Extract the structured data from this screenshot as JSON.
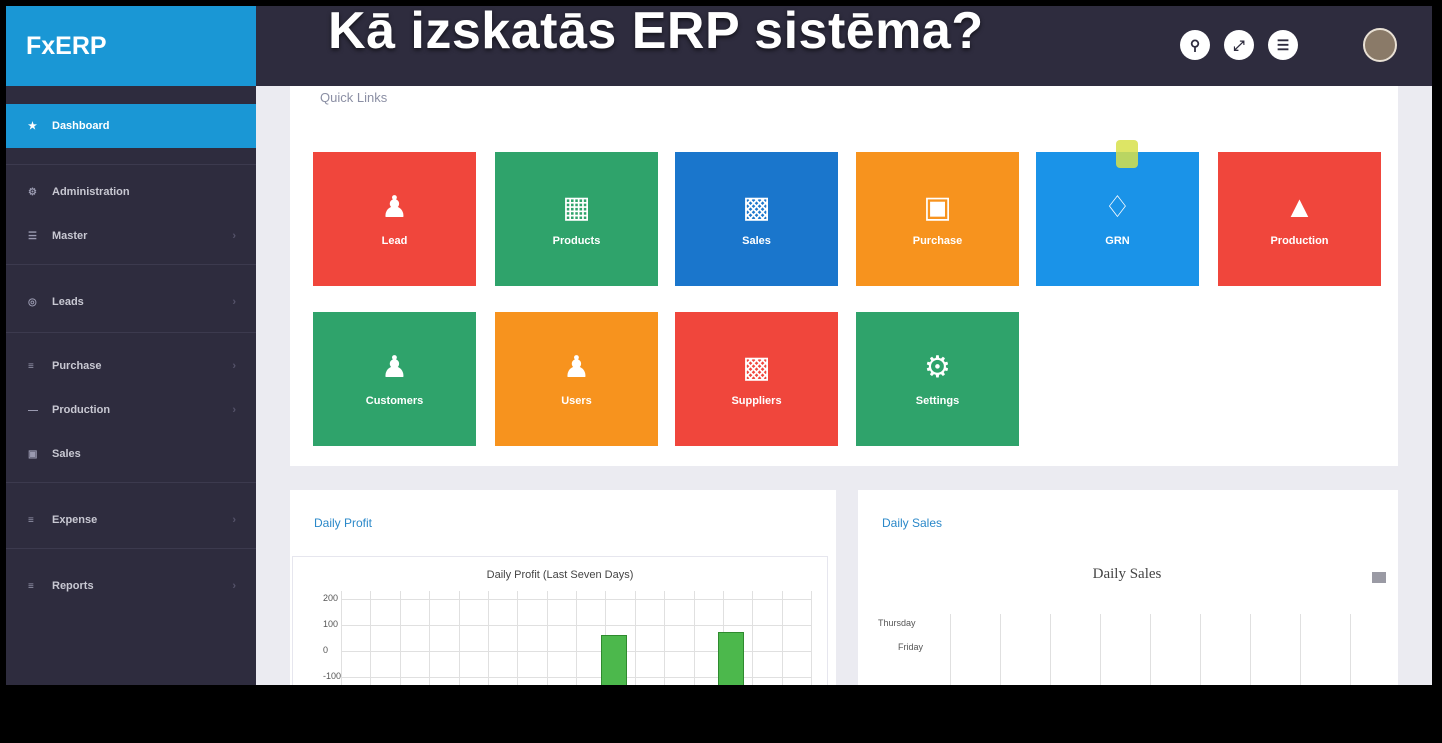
{
  "video_title": "Kā izskatās ERP sistēma?",
  "brand": "FxERP",
  "topbar_icons": [
    "search-icon",
    "expand-icon",
    "menu-icon"
  ],
  "sidebar": {
    "items": [
      {
        "label": "Dashboard",
        "icon": "home-icon",
        "active": true
      },
      {
        "label": "Administration",
        "icon": "gear-icon"
      },
      {
        "label": "Master",
        "icon": "list-icon"
      },
      {
        "label": "Leads",
        "icon": "target-icon"
      },
      {
        "label": "Purchase",
        "icon": "cart-icon"
      },
      {
        "label": "Production",
        "icon": "factory-icon"
      },
      {
        "label": "Sales",
        "icon": "tag-icon"
      },
      {
        "label": "Expense",
        "icon": "wallet-icon"
      },
      {
        "label": "Reports",
        "icon": "chart-icon"
      }
    ]
  },
  "quick_links": {
    "title": "Quick Links",
    "tiles": [
      {
        "label": "Lead",
        "icon": "user-icon",
        "color": "#f0463c"
      },
      {
        "label": "Products",
        "icon": "barcode-icon",
        "color": "#2fa36b"
      },
      {
        "label": "Sales",
        "icon": "money-icon",
        "color": "#1a76cc"
      },
      {
        "label": "Purchase",
        "icon": "cart-icon",
        "color": "#f7931e"
      },
      {
        "label": "GRN",
        "icon": "diamond-icon",
        "color": "#1a93e8"
      },
      {
        "label": "Production",
        "icon": "factory-icon",
        "color": "#f0463c"
      },
      {
        "label": "Customers",
        "icon": "user-icon",
        "color": "#2fa36b"
      },
      {
        "label": "Users",
        "icon": "user-icon",
        "color": "#f7931e"
      },
      {
        "label": "Suppliers",
        "icon": "briefcase-icon",
        "color": "#f0463c"
      },
      {
        "label": "Settings",
        "icon": "gear-icon",
        "color": "#2fa36b"
      }
    ]
  },
  "daily_profit": {
    "card_title": "Daily Profit",
    "chart_data": {
      "type": "bar",
      "title": "Daily Profit (Last Seven Days)",
      "ytick_labels": [
        "200",
        "100",
        "0",
        "-100"
      ],
      "values": [
        0,
        0,
        0,
        0,
        62,
        0,
        75,
        0
      ],
      "color": "#4cb84c"
    }
  },
  "daily_sales": {
    "card_title": "Daily Sales",
    "chart_data": {
      "type": "bar",
      "title": "Daily Sales",
      "row_labels": [
        "Thursday",
        "Friday"
      ]
    }
  }
}
